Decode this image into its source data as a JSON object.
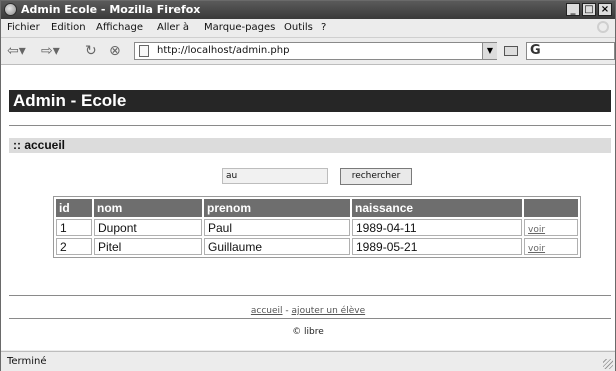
{
  "window": {
    "title": "Admin Ecole - Mozilla Firefox"
  },
  "menubar": {
    "items": [
      {
        "label": "Fichier"
      },
      {
        "label": "Edition"
      },
      {
        "label": "Affichage"
      },
      {
        "label": "Aller à"
      },
      {
        "label": "Marque-pages"
      },
      {
        "label": "Outils"
      },
      {
        "label": "?"
      }
    ]
  },
  "navbar": {
    "url": "http://localhost/admin.php",
    "search_engine_glyph": "G",
    "back_icon": "back-arrow-icon",
    "forward_icon": "forward-arrow-icon",
    "reload_icon": "reload-icon",
    "stop_icon": "stop-icon"
  },
  "page": {
    "header": "Admin - Ecole",
    "section_title": ":: accueil",
    "search": {
      "value": "au",
      "button_label": "rechercher"
    },
    "table": {
      "columns": [
        "id",
        "nom",
        "prenom",
        "naissance",
        ""
      ],
      "rows": [
        {
          "id": "1",
          "nom": "Dupont",
          "prenom": "Paul",
          "naissance": "1989-04-11",
          "action": "voir"
        },
        {
          "id": "2",
          "nom": "Pitel",
          "prenom": "Guillaume",
          "naissance": "1989-05-21",
          "action": "voir"
        }
      ]
    },
    "footer": {
      "link_home": "accueil",
      "separator": "-",
      "link_add": "ajouter un élève",
      "copyright": "© libre"
    }
  },
  "statusbar": {
    "status": "Terminé"
  },
  "colors": {
    "header_bg": "#262626",
    "table_header_bg": "#6e6e6e",
    "section_bg": "#dcdcdc"
  }
}
